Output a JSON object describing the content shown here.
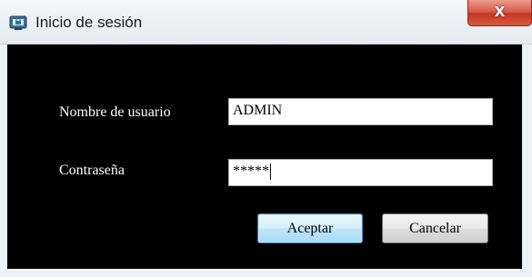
{
  "window": {
    "title": "Inicio de sesión",
    "title_icon": "login-app-icon",
    "close_label": "X"
  },
  "form": {
    "username_label": "Nombre de usuario",
    "username_value": "ADMIN",
    "password_label": "Contraseña",
    "password_value": "*****"
  },
  "buttons": {
    "accept_label": "Aceptar",
    "cancel_label": "Cancelar"
  },
  "colors": {
    "client_background": "#000000",
    "close_button": "#c53525",
    "accept_button_border": "#3c7fb1"
  }
}
